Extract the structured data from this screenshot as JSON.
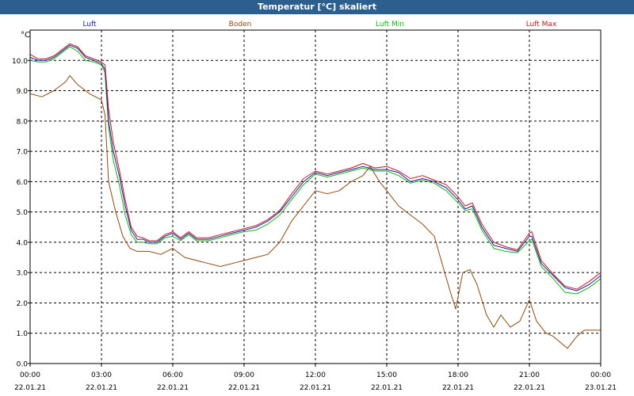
{
  "window": {
    "title": "Temperatur [°C] skaliert"
  },
  "chart_data": {
    "type": "line",
    "title": "Temperatur [°C] skaliert",
    "ylabel": "°C",
    "xlabel": "",
    "ylim": [
      0,
      11
    ],
    "yticks": [
      "0.0",
      "1.0",
      "2.0",
      "3.0",
      "4.0",
      "5.0",
      "6.0",
      "7.0",
      "8.0",
      "9.0",
      "10.0"
    ],
    "xlim_hours": [
      0,
      24
    ],
    "xticks": [
      {
        "time": "00:00",
        "date": "22.01.21",
        "h": 0
      },
      {
        "time": "03:00",
        "date": "22.01.21",
        "h": 3
      },
      {
        "time": "06:00",
        "date": "22.01.21",
        "h": 6
      },
      {
        "time": "09:00",
        "date": "22.01.21",
        "h": 9
      },
      {
        "time": "12:00",
        "date": "22.01.21",
        "h": 12
      },
      {
        "time": "15:00",
        "date": "22.01.21",
        "h": 15
      },
      {
        "time": "18:00",
        "date": "22.01.21",
        "h": 18
      },
      {
        "time": "21:00",
        "date": "22.01.21",
        "h": 21
      },
      {
        "time": "00:00",
        "date": "23.01.21",
        "h": 24
      }
    ],
    "grid": true,
    "legend_position": "top",
    "series": [
      {
        "name": "Luft",
        "color": "#1a1aa8",
        "points": [
          [
            0,
            10.1
          ],
          [
            0.33,
            10.0
          ],
          [
            0.67,
            10.0
          ],
          [
            1,
            10.1
          ],
          [
            1.33,
            10.3
          ],
          [
            1.67,
            10.5
          ],
          [
            2,
            10.4
          ],
          [
            2.33,
            10.1
          ],
          [
            2.67,
            10.0
          ],
          [
            3,
            9.9
          ],
          [
            3.15,
            9.7
          ],
          [
            3.3,
            8.0
          ],
          [
            3.5,
            7.0
          ],
          [
            3.75,
            6.2
          ],
          [
            4,
            5.2
          ],
          [
            4.25,
            4.4
          ],
          [
            4.5,
            4.1
          ],
          [
            4.75,
            4.1
          ],
          [
            5,
            4.0
          ],
          [
            5.33,
            4.0
          ],
          [
            5.67,
            4.2
          ],
          [
            6,
            4.3
          ],
          [
            6.33,
            4.1
          ],
          [
            6.67,
            4.3
          ],
          [
            7,
            4.1
          ],
          [
            7.5,
            4.1
          ],
          [
            8,
            4.2
          ],
          [
            8.5,
            4.3
          ],
          [
            9,
            4.4
          ],
          [
            9.5,
            4.5
          ],
          [
            10,
            4.7
          ],
          [
            10.5,
            5.0
          ],
          [
            11,
            5.5
          ],
          [
            11.5,
            6.0
          ],
          [
            12,
            6.3
          ],
          [
            12.5,
            6.2
          ],
          [
            13,
            6.3
          ],
          [
            13.5,
            6.4
          ],
          [
            14,
            6.5
          ],
          [
            14.5,
            6.4
          ],
          [
            15,
            6.4
          ],
          [
            15.5,
            6.3
          ],
          [
            16,
            6.0
          ],
          [
            16.5,
            6.1
          ],
          [
            17,
            6.0
          ],
          [
            17.5,
            5.8
          ],
          [
            18,
            5.4
          ],
          [
            18.3,
            5.1
          ],
          [
            18.6,
            5.2
          ],
          [
            19,
            4.5
          ],
          [
            19.5,
            3.9
          ],
          [
            20,
            3.8
          ],
          [
            20.5,
            3.7
          ],
          [
            21,
            4.2
          ],
          [
            21.1,
            4.2
          ],
          [
            21.5,
            3.3
          ],
          [
            22,
            2.9
          ],
          [
            22.5,
            2.5
          ],
          [
            23,
            2.4
          ],
          [
            23.5,
            2.6
          ],
          [
            24,
            2.9
          ]
        ]
      },
      {
        "name": "Boden",
        "color": "#8b4a10",
        "points": [
          [
            0,
            8.9
          ],
          [
            0.5,
            8.8
          ],
          [
            1,
            9.0
          ],
          [
            1.5,
            9.3
          ],
          [
            1.67,
            9.5
          ],
          [
            2,
            9.2
          ],
          [
            2.5,
            8.9
          ],
          [
            3,
            8.7
          ],
          [
            3.15,
            8.2
          ],
          [
            3.3,
            6.0
          ],
          [
            3.6,
            5.0
          ],
          [
            3.9,
            4.2
          ],
          [
            4.2,
            3.8
          ],
          [
            4.5,
            3.7
          ],
          [
            5,
            3.7
          ],
          [
            5.5,
            3.6
          ],
          [
            6,
            3.8
          ],
          [
            6.5,
            3.5
          ],
          [
            7,
            3.4
          ],
          [
            7.5,
            3.3
          ],
          [
            8,
            3.2
          ],
          [
            8.5,
            3.3
          ],
          [
            9,
            3.4
          ],
          [
            9.5,
            3.5
          ],
          [
            10,
            3.6
          ],
          [
            10.5,
            4.0
          ],
          [
            11,
            4.7
          ],
          [
            11.5,
            5.2
          ],
          [
            12,
            5.7
          ],
          [
            12.5,
            5.6
          ],
          [
            13,
            5.7
          ],
          [
            13.5,
            6.0
          ],
          [
            14,
            6.2
          ],
          [
            14.3,
            6.5
          ],
          [
            14.7,
            6.0
          ],
          [
            15,
            5.7
          ],
          [
            15.5,
            5.2
          ],
          [
            16,
            4.9
          ],
          [
            16.5,
            4.6
          ],
          [
            17,
            4.2
          ],
          [
            17.4,
            3.1
          ],
          [
            17.7,
            2.3
          ],
          [
            17.9,
            1.8
          ],
          [
            18.2,
            3.0
          ],
          [
            18.5,
            3.1
          ],
          [
            18.8,
            2.6
          ],
          [
            19.2,
            1.6
          ],
          [
            19.5,
            1.2
          ],
          [
            19.8,
            1.6
          ],
          [
            20.2,
            1.2
          ],
          [
            20.6,
            1.4
          ],
          [
            21,
            2.1
          ],
          [
            21.3,
            1.4
          ],
          [
            21.7,
            1.0
          ],
          [
            22,
            0.9
          ],
          [
            22.3,
            0.7
          ],
          [
            22.6,
            0.5
          ],
          [
            23,
            0.9
          ],
          [
            23.3,
            1.1
          ],
          [
            23.7,
            1.1
          ],
          [
            24,
            1.1
          ]
        ]
      },
      {
        "name": "Luft Min",
        "color": "#12b412",
        "points": [
          [
            0,
            10.0
          ],
          [
            0.33,
            9.95
          ],
          [
            0.67,
            9.95
          ],
          [
            1,
            10.05
          ],
          [
            1.33,
            10.25
          ],
          [
            1.67,
            10.45
          ],
          [
            2,
            10.3
          ],
          [
            2.33,
            10.0
          ],
          [
            2.67,
            9.95
          ],
          [
            3,
            9.85
          ],
          [
            3.15,
            9.6
          ],
          [
            3.3,
            7.8
          ],
          [
            3.5,
            6.7
          ],
          [
            3.75,
            5.9
          ],
          [
            4,
            4.9
          ],
          [
            4.25,
            4.25
          ],
          [
            4.5,
            4.0
          ],
          [
            4.75,
            4.0
          ],
          [
            5,
            3.95
          ],
          [
            5.33,
            3.95
          ],
          [
            5.67,
            4.15
          ],
          [
            6,
            4.2
          ],
          [
            6.33,
            4.05
          ],
          [
            6.67,
            4.25
          ],
          [
            7,
            4.05
          ],
          [
            7.5,
            4.05
          ],
          [
            8,
            4.15
          ],
          [
            8.5,
            4.25
          ],
          [
            9,
            4.35
          ],
          [
            9.5,
            4.4
          ],
          [
            10,
            4.6
          ],
          [
            10.5,
            4.9
          ],
          [
            11,
            5.4
          ],
          [
            11.5,
            5.9
          ],
          [
            12,
            6.25
          ],
          [
            12.5,
            6.15
          ],
          [
            13,
            6.25
          ],
          [
            13.5,
            6.35
          ],
          [
            14,
            6.45
          ],
          [
            14.5,
            6.35
          ],
          [
            15,
            6.35
          ],
          [
            15.5,
            6.2
          ],
          [
            16,
            5.95
          ],
          [
            16.5,
            6.05
          ],
          [
            17,
            5.95
          ],
          [
            17.5,
            5.7
          ],
          [
            18,
            5.3
          ],
          [
            18.3,
            5.05
          ],
          [
            18.6,
            5.1
          ],
          [
            19,
            4.4
          ],
          [
            19.5,
            3.8
          ],
          [
            20,
            3.7
          ],
          [
            20.5,
            3.65
          ],
          [
            21,
            4.05
          ],
          [
            21.1,
            4.1
          ],
          [
            21.5,
            3.2
          ],
          [
            22,
            2.8
          ],
          [
            22.5,
            2.35
          ],
          [
            23,
            2.3
          ],
          [
            23.5,
            2.5
          ],
          [
            24,
            2.8
          ]
        ]
      },
      {
        "name": "Luft Max",
        "color": "#c01818",
        "points": [
          [
            0,
            10.2
          ],
          [
            0.33,
            10.05
          ],
          [
            0.67,
            10.05
          ],
          [
            1,
            10.15
          ],
          [
            1.33,
            10.35
          ],
          [
            1.67,
            10.55
          ],
          [
            2,
            10.45
          ],
          [
            2.33,
            10.15
          ],
          [
            2.67,
            10.05
          ],
          [
            3,
            9.95
          ],
          [
            3.15,
            9.85
          ],
          [
            3.3,
            8.4
          ],
          [
            3.5,
            7.3
          ],
          [
            3.75,
            6.4
          ],
          [
            4,
            5.4
          ],
          [
            4.25,
            4.5
          ],
          [
            4.5,
            4.2
          ],
          [
            4.75,
            4.15
          ],
          [
            5,
            4.05
          ],
          [
            5.33,
            4.05
          ],
          [
            5.67,
            4.25
          ],
          [
            6,
            4.35
          ],
          [
            6.33,
            4.15
          ],
          [
            6.67,
            4.35
          ],
          [
            7,
            4.15
          ],
          [
            7.5,
            4.15
          ],
          [
            8,
            4.25
          ],
          [
            8.5,
            4.35
          ],
          [
            9,
            4.45
          ],
          [
            9.5,
            4.55
          ],
          [
            10,
            4.75
          ],
          [
            10.5,
            5.05
          ],
          [
            11,
            5.6
          ],
          [
            11.5,
            6.1
          ],
          [
            12,
            6.35
          ],
          [
            12.5,
            6.25
          ],
          [
            13,
            6.35
          ],
          [
            13.5,
            6.45
          ],
          [
            14,
            6.6
          ],
          [
            14.5,
            6.45
          ],
          [
            15,
            6.5
          ],
          [
            15.5,
            6.35
          ],
          [
            16,
            6.1
          ],
          [
            16.5,
            6.2
          ],
          [
            17,
            6.05
          ],
          [
            17.5,
            5.9
          ],
          [
            18,
            5.5
          ],
          [
            18.3,
            5.2
          ],
          [
            18.6,
            5.3
          ],
          [
            19,
            4.6
          ],
          [
            19.5,
            4.0
          ],
          [
            20,
            3.85
          ],
          [
            20.5,
            3.75
          ],
          [
            21,
            4.3
          ],
          [
            21.1,
            4.35
          ],
          [
            21.5,
            3.4
          ],
          [
            22,
            2.95
          ],
          [
            22.5,
            2.55
          ],
          [
            23,
            2.45
          ],
          [
            23.5,
            2.7
          ],
          [
            24,
            3.0
          ]
        ]
      }
    ]
  }
}
